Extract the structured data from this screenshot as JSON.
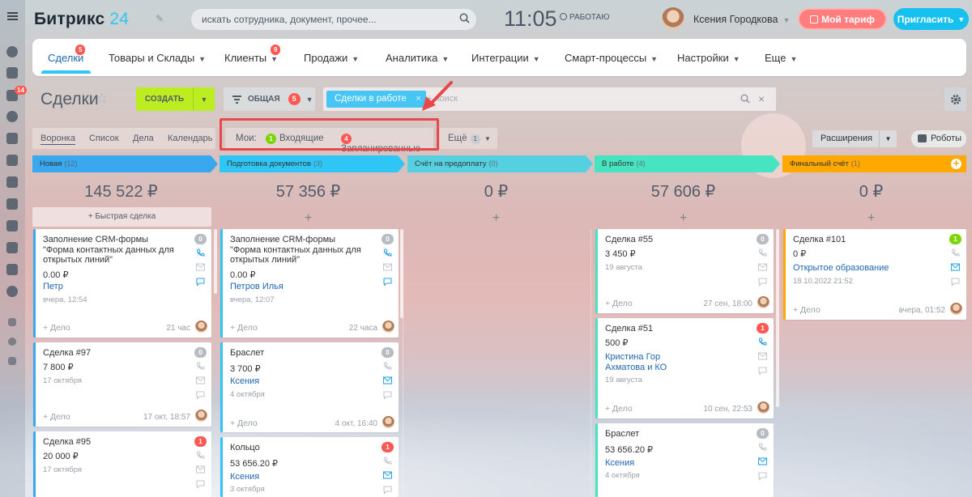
{
  "header": {
    "logo_text": "Битрикс",
    "logo_num": "24",
    "search_placeholder": "искать сотрудника, документ, прочее...",
    "time": "11:05",
    "work_status": "РАБОТАЮ",
    "user_name": "Ксения Городкова",
    "tariff_label": "Мой тариф",
    "invite_label": "Пригласить"
  },
  "left_rail": {
    "badge": "14"
  },
  "nav": {
    "items": [
      {
        "label": "Сделки",
        "badge": "5"
      },
      {
        "label": "Товары и Склады"
      },
      {
        "label": "Клиенты",
        "badge": "9"
      },
      {
        "label": "Продажи"
      },
      {
        "label": "Аналитика"
      },
      {
        "label": "Интеграции"
      },
      {
        "label": "Смарт-процессы"
      },
      {
        "label": "Настройки"
      },
      {
        "label": "Еще"
      }
    ]
  },
  "toolbar": {
    "page_title": "Сделки",
    "create_label": "СОЗДАТЬ",
    "general_label": "ОБЩАЯ",
    "general_count": "5",
    "filter_tag": "Сделки в работе",
    "filter_placeholder": "+ поиск"
  },
  "views": {
    "tabs": [
      "Воронка",
      "Список",
      "Дела",
      "Календарь"
    ],
    "my_label": "Мои:",
    "incoming_count": "1",
    "incoming_label": "Входящие",
    "planned_count": "4",
    "planned_label": "Запланированные",
    "more_label": "Ещё",
    "more_count": "1",
    "extensions_label": "Расширения",
    "robots_label": "Роботы"
  },
  "colors": {
    "stage_new": "#39a8ef",
    "stage_docs": "#2fc6f6",
    "stage_prepay": "#55d0e0",
    "stage_work": "#47e4c2",
    "stage_final": "#ffa900",
    "accent": "#2fc6f6",
    "create": "#bbed21",
    "badge_red": "#ff5752"
  },
  "columns": [
    {
      "stage": "Новая",
      "count": "(12)",
      "sum": "145 522 ₽",
      "quick_add": "+ Быстрая сделка",
      "cards": [
        {
          "title": "Заполнение CRM-формы \"Форма контактных данных для открытых линий\"",
          "price": "0.00 ₽",
          "link": "Петр",
          "date": "вчера, 12:54",
          "deal": "+ Дело",
          "when": "21 час",
          "badge": "0"
        },
        {
          "title": "Сделка #97",
          "price": "7 800 ₽",
          "date": "17 октября",
          "deal": "+ Дело",
          "when": "17 окт, 18:57",
          "badge": "0"
        },
        {
          "title": "Сделка #95",
          "price": "20 000 ₽",
          "date": "17 октября",
          "badge": "1"
        }
      ]
    },
    {
      "stage": "Подготовка документов",
      "count": "(3)",
      "sum": "57 356 ₽",
      "cards": [
        {
          "title": "Заполнение CRM-формы \"Форма контактных данных для открытых линий\"",
          "price": "0.00 ₽",
          "link": "Петров Илья",
          "date": "вчера, 12:07",
          "deal": "+ Дело",
          "when": "22 часа",
          "badge": "0"
        },
        {
          "title": "Браслет",
          "price": "3 700 ₽",
          "link": "Ксения",
          "date": "4 октября",
          "deal": "+ Дело",
          "when": "4 окт, 16:40",
          "badge": "0"
        },
        {
          "title": "Кольцо",
          "price": "53 656.20 ₽",
          "link": "Ксения",
          "date": "3 октября",
          "badge": "1"
        }
      ]
    },
    {
      "stage": "Счёт на предоплату",
      "count": "(0)",
      "sum": "0 ₽",
      "cards": []
    },
    {
      "stage": "В работе",
      "count": "(4)",
      "sum": "57 606 ₽",
      "cards": [
        {
          "title": "Сделка #55",
          "price": "3 450 ₽",
          "date": "19 августа",
          "deal": "+ Дело",
          "when": "27 сен, 18:00",
          "badge": "0"
        },
        {
          "title": "Сделка #51",
          "price": "500 ₽",
          "link": "Кристина Гор",
          "link2": "Ахматова и КО",
          "date": "19 августа",
          "deal": "+ Дело",
          "when": "10 сен, 22:53",
          "badge": "1"
        },
        {
          "title": "Браслет",
          "price": "53 656.20 ₽",
          "link": "Ксения",
          "date": "4 октября",
          "badge": "0"
        }
      ]
    },
    {
      "stage": "Финальный счёт",
      "count": "(1)",
      "sum": "0 ₽",
      "cards": [
        {
          "title": "Сделка #101",
          "price": "0 ₽",
          "link": "Открытое образование",
          "date": "18.10.2022 21:52",
          "deal": "+ Дело",
          "when": "вчера, 01:52",
          "badge": "1"
        }
      ]
    }
  ]
}
